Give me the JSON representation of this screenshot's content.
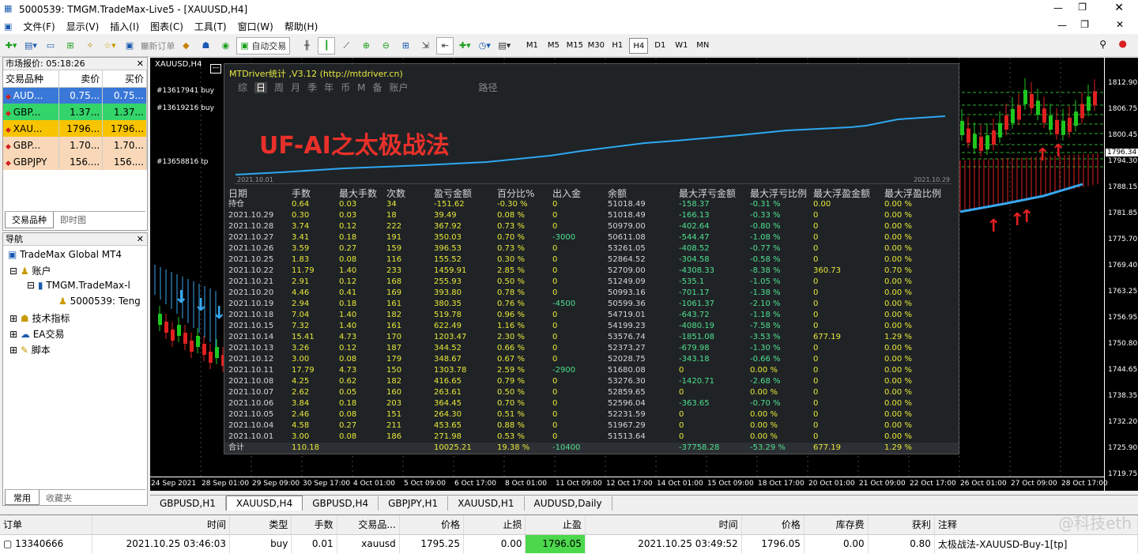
{
  "window": {
    "title": "5000539: TMGM.TradeMax-Live5 - [XAUUSD,H4]"
  },
  "menu": [
    "文件(F)",
    "显示(V)",
    "插入(I)",
    "图表(C)",
    "工具(T)",
    "窗口(W)",
    "帮助(H)"
  ],
  "toolbar": {
    "new_order": "新订单",
    "auto_trade": "自动交易",
    "timeframes": [
      "M1",
      "M5",
      "M15",
      "M30",
      "H1",
      "H4",
      "D1",
      "W1",
      "MN"
    ],
    "active_tf": "H4"
  },
  "market_watch": {
    "title": "市场报价: 05:18:26",
    "headers": [
      "交易品种",
      "卖价",
      "买价"
    ],
    "rows": [
      {
        "sym": "AUD...",
        "bid": "0.75...",
        "ask": "0.75...",
        "bg": "#3a78d8",
        "fg": "#ffffff"
      },
      {
        "sym": "GBP...",
        "bid": "1.37...",
        "ask": "1.37...",
        "bg": "#33d46a",
        "fg": "#000000"
      },
      {
        "sym": "XAU...",
        "bid": "1796...",
        "ask": "1796...",
        "bg": "#f8c400",
        "fg": "#000000"
      },
      {
        "sym": "GBP...",
        "bid": "1.70...",
        "ask": "1.70...",
        "bg": "#f8d8b8",
        "fg": "#000000"
      },
      {
        "sym": "GBPJPY",
        "bid": "156....",
        "ask": "156....",
        "bg": "#f8d8b8",
        "fg": "#000000"
      }
    ],
    "tabs": [
      "交易品种",
      "即时图"
    ]
  },
  "navigator": {
    "title": "导航",
    "items": [
      "TradeMax Global MT4",
      "账户",
      "TMGM.TradeMax-l",
      "5000539: Teng",
      "技术指标",
      "EA交易",
      "脚本"
    ],
    "tabs": [
      "常用",
      "收藏夹"
    ]
  },
  "chart": {
    "symbol": "XAUUSD,H4",
    "y_ticks": [
      "1812.90",
      "1806.75",
      "1800.45",
      "1796.34",
      "1794.30",
      "1788.15",
      "1781.85",
      "1775.70",
      "1769.40",
      "1763.25",
      "1756.95",
      "1750.80",
      "1744.65",
      "1738.35",
      "1732.20",
      "1725.90",
      "1719.75"
    ],
    "x_ticks": [
      "24 Sep 2021",
      "28 Sep 01:00",
      "29 Sep 09:00",
      "30 Sep 17:00",
      "4 Oct 01:00",
      "5 Oct 09:00",
      "6 Oct 17:00",
      "8 Oct 01:00",
      "11 Oct 09:00",
      "12 Oct 17:00",
      "14 Oct 01:00",
      "15 Oct 09:00",
      "18 Oct 17:00",
      "20 Oct 01:00",
      "21 Oct 09:00",
      "22 Oct 17:00",
      "26 Oct 01:00",
      "27 Oct 09:00",
      "28 Oct 17:00"
    ],
    "order_labels": [
      "#13617941 buy",
      "#13619216 buy",
      "#13658816 tp"
    ],
    "current_price": "1796.34"
  },
  "stats": {
    "title": "MTDriver统计 ,V3.12 (http://mtdriver.cn)",
    "tabs": [
      "综",
      "日",
      "周",
      "月",
      "季",
      "年",
      "币",
      "M",
      "备",
      "账户",
      "路径"
    ],
    "active_tab": "日",
    "overlay_text": "UF-AI之太极战法",
    "curve_start": "2021.10.01",
    "curve_end": "2021.10.29",
    "headers": [
      "日期",
      "手数",
      "最大手数",
      "次数",
      "盈亏金额",
      "百分比%",
      "出入金",
      "余额",
      "最大浮亏金额",
      "最大浮亏比例",
      "最大浮盈金额",
      "最大浮盈比例"
    ],
    "rows": [
      [
        "持仓",
        "0.64",
        "0.03",
        "34",
        "-151.62",
        "-0.30 %",
        "0",
        "51018.49",
        "-158.37",
        "-0.31 %",
        "0.00",
        "0.00 %"
      ],
      [
        "2021.10.29",
        "0.30",
        "0.03",
        "18",
        "39.49",
        "0.08 %",
        "0",
        "51018.49",
        "-166.13",
        "-0.33 %",
        "0",
        "0.00 %"
      ],
      [
        "2021.10.28",
        "3.74",
        "0.12",
        "222",
        "367.92",
        "0.73 %",
        "0",
        "50979.00",
        "-402.64",
        "-0.80 %",
        "0",
        "0.00 %"
      ],
      [
        "2021.10.27",
        "3.41",
        "0.18",
        "191",
        "350.03",
        "0.70 %",
        "-3000",
        "50611.08",
        "-544.47",
        "-1.08 %",
        "0",
        "0.00 %"
      ],
      [
        "2021.10.26",
        "3.59",
        "0.27",
        "159",
        "396.53",
        "0.73 %",
        "0",
        "53261.05",
        "-408.52",
        "-0.77 %",
        "0",
        "0.00 %"
      ],
      [
        "2021.10.25",
        "1.83",
        "0.08",
        "116",
        "155.52",
        "0.30 %",
        "0",
        "52864.52",
        "-304.58",
        "-0.58 %",
        "0",
        "0.00 %"
      ],
      [
        "2021.10.22",
        "11.79",
        "1.40",
        "233",
        "1459.91",
        "2.85 %",
        "0",
        "52709.00",
        "-4308.33",
        "-8.38 %",
        "360.73",
        "0.70 %"
      ],
      [
        "2021.10.21",
        "2.91",
        "0.12",
        "168",
        "255.93",
        "0.50 %",
        "0",
        "51249.09",
        "-535.1",
        "-1.05 %",
        "0",
        "0.00 %"
      ],
      [
        "2021.10.20",
        "4.46",
        "0.41",
        "169",
        "393.80",
        "0.78 %",
        "0",
        "50993.16",
        "-701.17",
        "-1.38 %",
        "0",
        "0.00 %"
      ],
      [
        "2021.10.19",
        "2.94",
        "0.18",
        "161",
        "380.35",
        "0.76 %",
        "-4500",
        "50599.36",
        "-1061.37",
        "-2.10 %",
        "0",
        "0.00 %"
      ],
      [
        "2021.10.18",
        "7.04",
        "1.40",
        "182",
        "519.78",
        "0.96 %",
        "0",
        "54719.01",
        "-643.72",
        "-1.18 %",
        "0",
        "0.00 %"
      ],
      [
        "2021.10.15",
        "7.32",
        "1.40",
        "161",
        "622.49",
        "1.16 %",
        "0",
        "54199.23",
        "-4080.19",
        "-7.58 %",
        "0",
        "0.00 %"
      ],
      [
        "2021.10.14",
        "15.41",
        "4.73",
        "170",
        "1203.47",
        "2.30 %",
        "0",
        "53576.74",
        "-1851.08",
        "-3.53 %",
        "677.19",
        "1.29 %"
      ],
      [
        "2021.10.13",
        "3.26",
        "0.12",
        "187",
        "344.52",
        "0.66 %",
        "0",
        "52373.27",
        "-679.98",
        "-1.30 %",
        "0",
        "0.00 %"
      ],
      [
        "2021.10.12",
        "3.00",
        "0.08",
        "179",
        "348.67",
        "0.67 %",
        "0",
        "52028.75",
        "-343.18",
        "-0.66 %",
        "0",
        "0.00 %"
      ],
      [
        "2021.10.11",
        "17.79",
        "4.73",
        "150",
        "1303.78",
        "2.59 %",
        "-2900",
        "51680.08",
        "0",
        "0.00 %",
        "0",
        "0.00 %"
      ],
      [
        "2021.10.08",
        "4.25",
        "0.62",
        "182",
        "416.65",
        "0.79 %",
        "0",
        "53276.30",
        "-1420.71",
        "-2.68 %",
        "0",
        "0.00 %"
      ],
      [
        "2021.10.07",
        "2.62",
        "0.05",
        "160",
        "263.61",
        "0.50 %",
        "0",
        "52859.65",
        "0",
        "0.00 %",
        "0",
        "0.00 %"
      ],
      [
        "2021.10.06",
        "3.84",
        "0.18",
        "203",
        "364.45",
        "0.70 %",
        "0",
        "52596.04",
        "-363.65",
        "-0.70 %",
        "0",
        "0.00 %"
      ],
      [
        "2021.10.05",
        "2.46",
        "0.08",
        "151",
        "264.30",
        "0.51 %",
        "0",
        "52231.59",
        "0",
        "0.00 %",
        "0",
        "0.00 %"
      ],
      [
        "2021.10.04",
        "4.58",
        "0.27",
        "211",
        "453.65",
        "0.88 %",
        "0",
        "51967.29",
        "0",
        "0.00 %",
        "0",
        "0.00 %"
      ],
      [
        "2021.10.01",
        "3.00",
        "0.08",
        "186",
        "271.98",
        "0.53 %",
        "0",
        "51513.64",
        "0",
        "0.00 %",
        "0",
        "0.00 %"
      ]
    ],
    "total": [
      "合计",
      "110.18",
      "",
      "",
      "10025.21",
      "19.38 %",
      "-10400",
      "",
      "-37758.28",
      "-53.29 %",
      "677.19",
      "1.29 %"
    ]
  },
  "chart_tabs": [
    "GBPUSD,H1",
    "XAUUSD,H4",
    "GBPUSD,H4",
    "GBPJPY,H1",
    "XAUUSD,H1",
    "AUDUSD,Daily"
  ],
  "active_chart_tab": "XAUUSD,H4",
  "orders": {
    "headers": [
      "订单",
      "时间",
      "类型",
      "手数",
      "交易品...",
      "价格",
      "止损",
      "止盈",
      "时间",
      "价格",
      "库存费",
      "获利",
      "注释"
    ],
    "row": [
      "13340666",
      "2021.10.25 03:46:03",
      "buy",
      "0.01",
      "xauusd",
      "1795.25",
      "0.00",
      "1796.05",
      "2021.10.25 03:49:52",
      "1796.05",
      "0.00",
      "0.80",
      "太极战法-XAUUSD-Buy-1[tp]"
    ]
  },
  "watermark": "@科技eth"
}
